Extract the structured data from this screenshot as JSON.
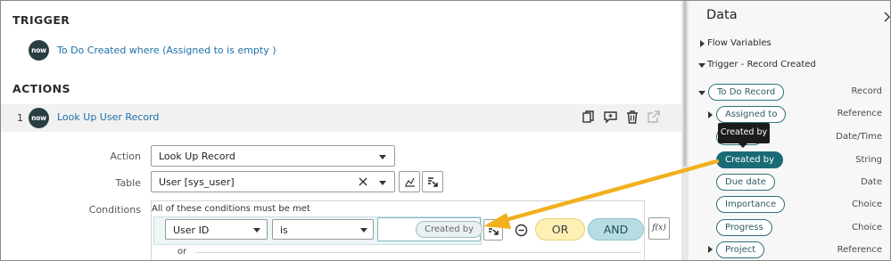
{
  "trigger": {
    "heading": "TRIGGER",
    "logo_text": "now",
    "description": "To Do Created where (Assigned to is empty )"
  },
  "actions": {
    "heading": "ACTIONS",
    "row": {
      "number": "1",
      "logo_text": "now",
      "title": "Look Up User Record",
      "icons": [
        "copy-icon",
        "comment-icon",
        "trash-icon",
        "open-external-icon"
      ]
    }
  },
  "form": {
    "action_label": "Action",
    "action_value": "Look Up Record",
    "table_label": "Table",
    "table_value": "User [sys_user]",
    "conditions_label": "Conditions",
    "conditions_title": "All of these conditions must be met",
    "condition": {
      "field": "User ID",
      "operator": "is",
      "value_pill": "Created by"
    },
    "or_label": "OR",
    "and_label": "AND",
    "or_separator": "or",
    "fx_label": "f(x)"
  },
  "data_panel": {
    "title": "Data",
    "sections": {
      "flow_variables": "Flow Variables",
      "trigger_record": "Trigger - Record Created"
    },
    "root": {
      "label": "To Do Record",
      "type": "Record"
    },
    "fields": [
      {
        "label": "Assigned to",
        "type": "Reference"
      },
      {
        "label": "",
        "type": "Date/Time"
      },
      {
        "label": "Created by",
        "type": "String"
      },
      {
        "label": "Due date",
        "type": "Date"
      },
      {
        "label": "Importance",
        "type": "Choice"
      },
      {
        "label": "Progress",
        "type": "Choice"
      },
      {
        "label": "Project",
        "type": "Reference"
      }
    ],
    "tooltip": "Created by"
  },
  "colors": {
    "accent_teal": "#1a6b76",
    "link_blue": "#1f6fa8",
    "annotation_arrow": "#f2b01e",
    "or_yellow": "#fdf1b5",
    "and_teal": "#b7dde3"
  }
}
